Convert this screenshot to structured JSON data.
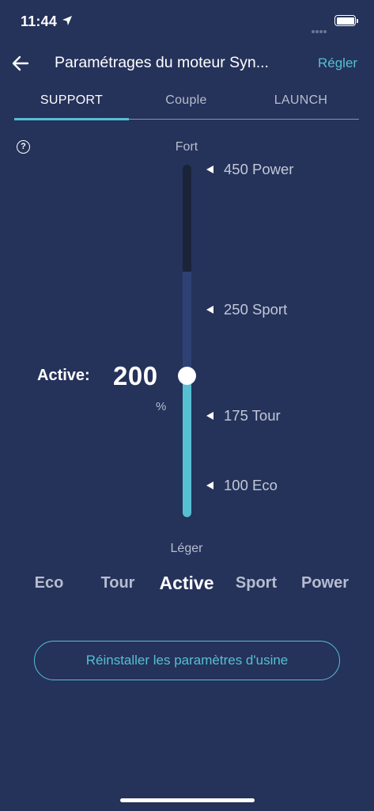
{
  "status_bar": {
    "time": "11:44",
    "icons": [
      "location-arrow-icon",
      "signal-dots-icon",
      "battery-icon"
    ]
  },
  "header": {
    "title": "Paramétrages du moteur Syn...",
    "action_label": "Régler",
    "back_icon": "arrow-left-icon"
  },
  "tabs": [
    {
      "label": "SUPPORT",
      "active": true
    },
    {
      "label": "Couple",
      "active": false
    },
    {
      "label": "LAUNCH",
      "active": false
    }
  ],
  "help": {
    "icon": "question-circle-icon",
    "glyph": "?"
  },
  "slider": {
    "top_label": "Fort",
    "bottom_label": "Léger",
    "markers": [
      {
        "value": "450",
        "name": "Power",
        "text": "450 Power"
      },
      {
        "value": "250",
        "name": "Sport",
        "text": "250 Sport"
      },
      {
        "value": "175",
        "name": "Tour",
        "text": "175 Tour"
      },
      {
        "value": "100",
        "name": "Eco",
        "text": "100 Eco"
      }
    ],
    "current_label": "Active:",
    "current_value": "200",
    "unit": "%"
  },
  "modes": [
    {
      "label": "Eco",
      "active": false
    },
    {
      "label": "Tour",
      "active": false
    },
    {
      "label": "Active",
      "active": true
    },
    {
      "label": "Sport",
      "active": false
    },
    {
      "label": "Power",
      "active": false
    }
  ],
  "reset_button": {
    "label": "Réinstaller les paramètres d'usine"
  },
  "colors": {
    "background": "#25325a",
    "accent": "#56bfd2",
    "track_dark": "#1b2338",
    "track_mid": "#2e4174",
    "muted_text": "#b7bdcf"
  }
}
